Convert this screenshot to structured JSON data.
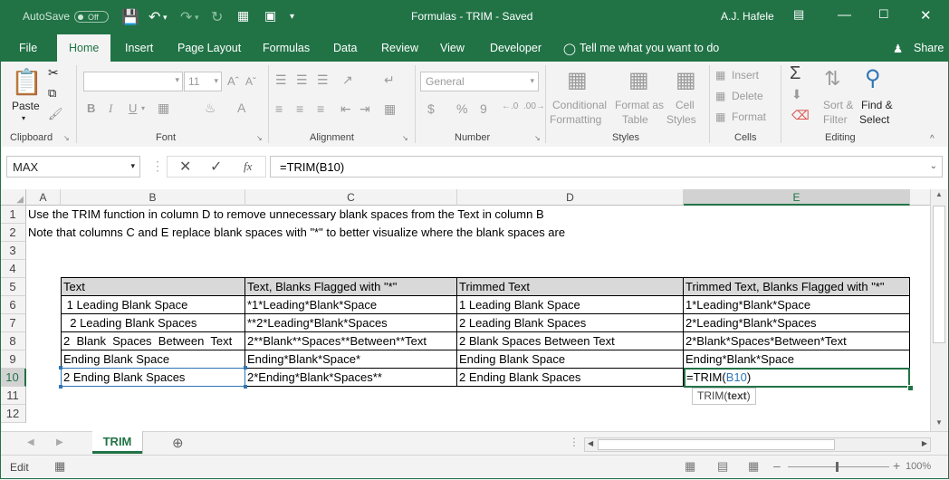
{
  "titlebar": {
    "autosave_label": "AutoSave",
    "autosave_state": "Off",
    "document_title": "Formulas - TRIM  -  Saved",
    "user_name": "A.J. Hafele"
  },
  "tabs": [
    "File",
    "Home",
    "Insert",
    "Page Layout",
    "Formulas",
    "Data",
    "Review",
    "View",
    "Developer"
  ],
  "active_tab": "Home",
  "tell_me": "Tell me what you want to do",
  "share_label": "Share",
  "ribbon": {
    "clipboard": {
      "paste": "Paste",
      "label": "Clipboard"
    },
    "font": {
      "font_size": "11",
      "bold": "B",
      "italic": "I",
      "underline": "U",
      "label": "Font"
    },
    "alignment": {
      "label": "Alignment"
    },
    "number": {
      "format": "General",
      "currency": "$",
      "percent": "%",
      "comma": "9",
      "label": "Number"
    },
    "styles": {
      "conditional": "Conditional",
      "conditional2": "Formatting",
      "format_as": "Format as",
      "format_as2": "Table",
      "cell": "Cell",
      "cell2": "Styles",
      "label": "Styles"
    },
    "cells": {
      "insert": "Insert",
      "delete": "Delete",
      "format": "Format",
      "label": "Cells"
    },
    "editing": {
      "sort": "Sort &",
      "sort2": "Filter",
      "find": "Find &",
      "find2": "Select",
      "label": "Editing"
    }
  },
  "formula_bar": {
    "name_box": "MAX",
    "fx": "fx",
    "formula": "=TRIM(B10)"
  },
  "columns": [
    "A",
    "B",
    "C",
    "D",
    "E"
  ],
  "rows": [
    "1",
    "2",
    "3",
    "4",
    "5",
    "6",
    "7",
    "8",
    "9",
    "10",
    "11",
    "12"
  ],
  "notes": {
    "row1": "Use the TRIM function in column D to remove unnecessary blank spaces from the Text in column B",
    "row2": "Note that columns C and E replace blank spaces with \"*\" to better visualize where the blank spaces are"
  },
  "table": {
    "headers": [
      "Text",
      "Text, Blanks Flagged with \"*\"",
      "Trimmed Text",
      "Trimmed Text, Blanks Flagged with \"*\""
    ],
    "rows": [
      [
        " 1 Leading Blank Space",
        "*1*Leading*Blank*Space",
        "1 Leading Blank Space",
        "1*Leading*Blank*Space"
      ],
      [
        "  2 Leading Blank Spaces",
        "**2*Leading*Blank*Spaces",
        "2 Leading Blank Spaces",
        "2*Leading*Blank*Spaces"
      ],
      [
        "2  Blank  Spaces  Between  Text",
        "2**Blank**Spaces**Between**Text",
        "2 Blank Spaces Between Text",
        "2*Blank*Spaces*Between*Text"
      ],
      [
        "Ending Blank Space ",
        "Ending*Blank*Space*",
        "Ending Blank Space",
        "Ending*Blank*Space"
      ],
      [
        "2 Ending Blank Spaces  ",
        "2*Ending*Blank*Spaces**",
        "2 Ending Blank Spaces",
        ""
      ]
    ]
  },
  "editing_cell": {
    "prefix": "=TRIM(",
    "ref": "B10",
    "suffix": ")"
  },
  "tooltip": {
    "fn": "TRIM(",
    "arg": "text",
    "close": ")"
  },
  "sheet_tab": "TRIM",
  "status": {
    "mode": "Edit",
    "zoom": "100%"
  },
  "colors": {
    "excel_green": "#217346",
    "ref_blue": "#2e75b6"
  }
}
